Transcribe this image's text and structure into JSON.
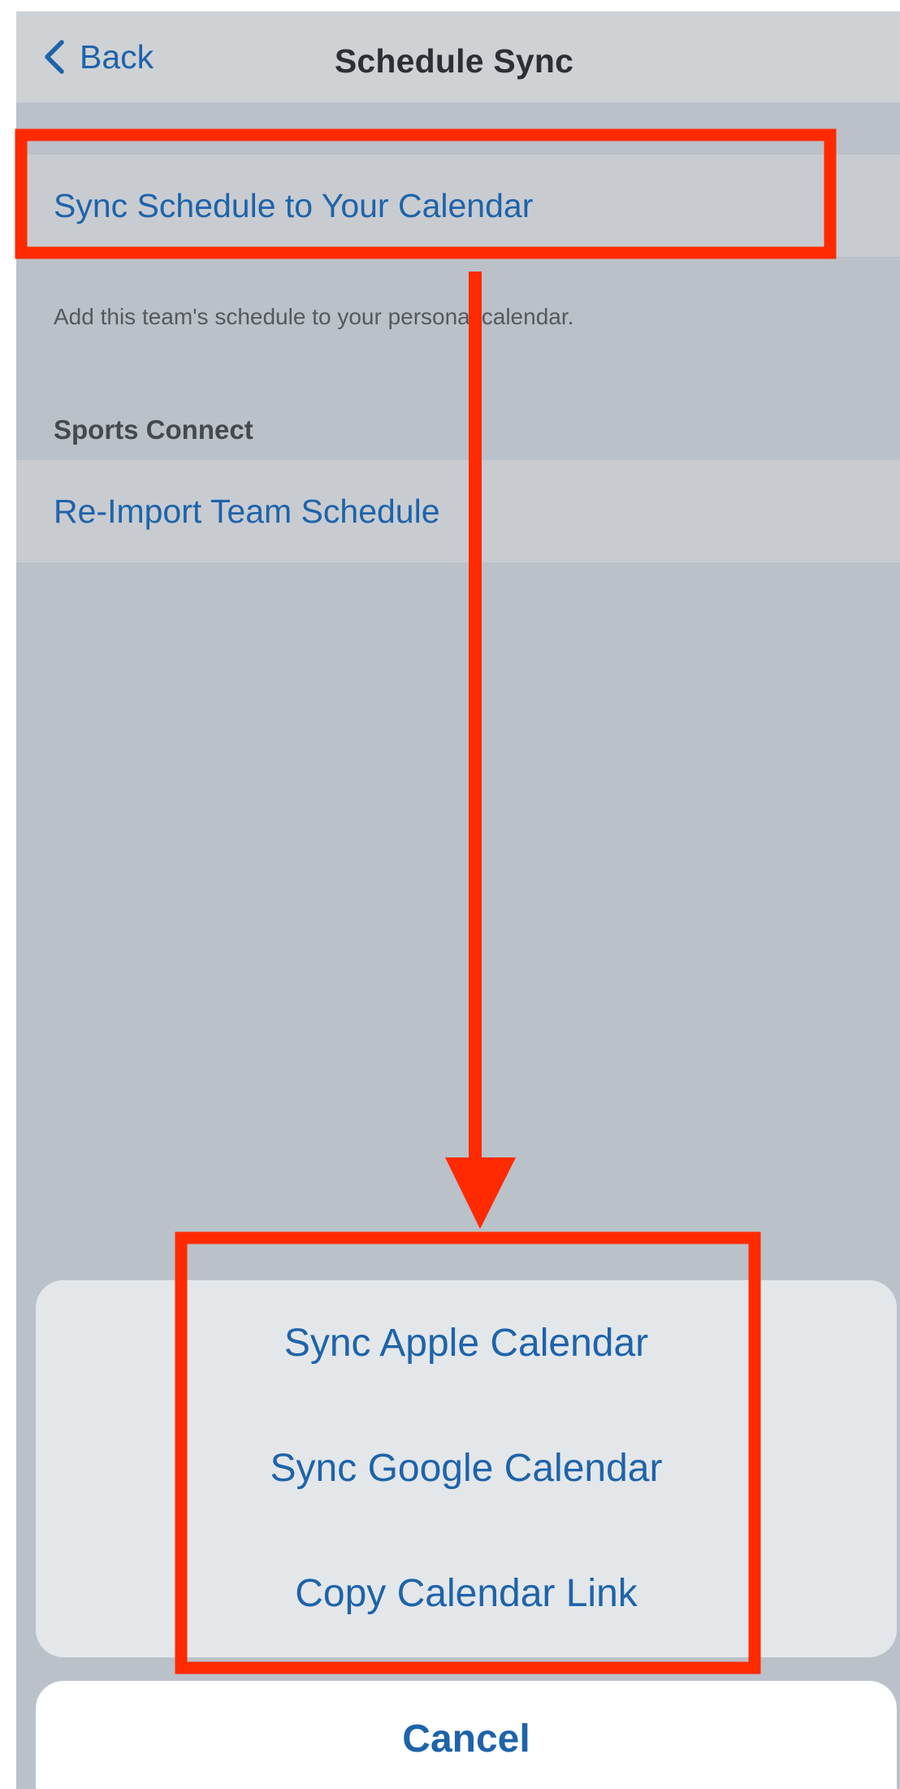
{
  "navbar": {
    "back_label": "Back",
    "title": "Schedule Sync"
  },
  "calendar_section": {
    "sync_row_label": "Sync Schedule to Your Calendar",
    "footer": "Add this team's schedule to your personal calendar."
  },
  "sports_connect_section": {
    "header": "Sports Connect",
    "reimport_label": "Re-Import Team Schedule"
  },
  "action_sheet": {
    "options": [
      "Sync Apple Calendar",
      "Sync Google Calendar",
      "Copy Calendar Link"
    ],
    "cancel_label": "Cancel"
  },
  "colors": {
    "link_blue": "#1e63aa",
    "annotation_red": "#ff2a00",
    "background": "#bac1c9"
  },
  "icons": {
    "back": "chevron-left-icon",
    "annotation_arrow": "arrow-down-icon"
  }
}
